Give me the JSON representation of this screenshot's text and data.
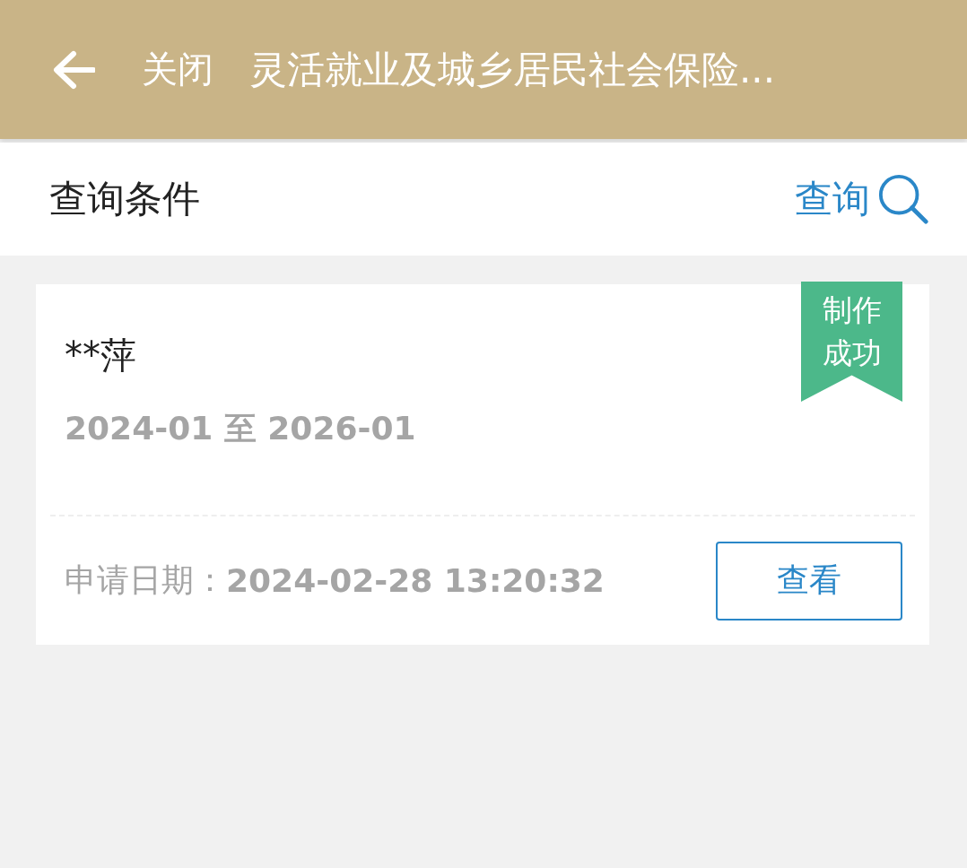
{
  "header": {
    "close": "关闭",
    "title": "灵活就业及城乡居民社会保险..."
  },
  "query_bar": {
    "label": "查询条件",
    "action": "查询"
  },
  "records": [
    {
      "name": "**萍",
      "period": "2024-01 至 2026-01",
      "status": "制作成功",
      "color": "#4cb88a",
      "date_label": "申请日期：",
      "date": "2024-02-28 13:20:32",
      "button": "查看"
    }
  ]
}
